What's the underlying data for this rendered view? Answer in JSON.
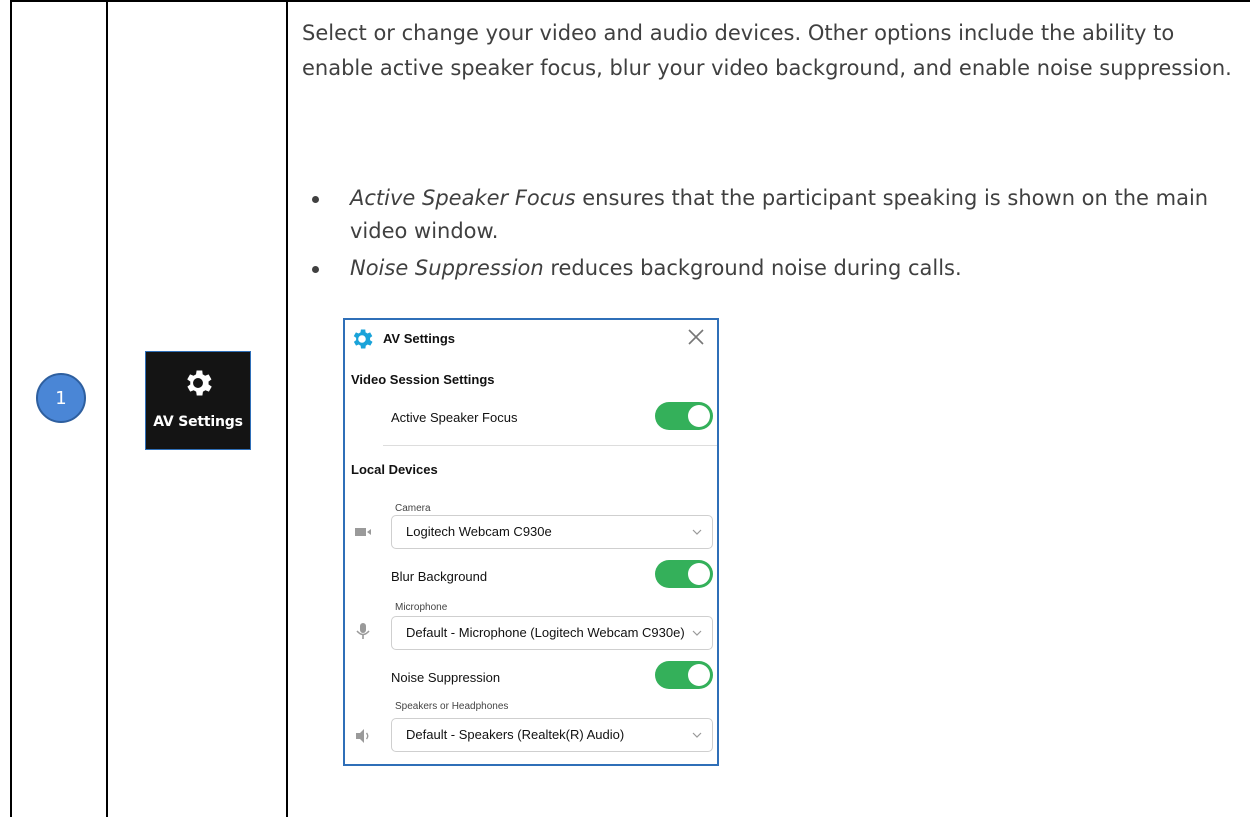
{
  "step": {
    "number": "1"
  },
  "tile": {
    "label": "AV Settings",
    "icon": "gear-icon"
  },
  "description": {
    "intro": "Select or change your video and audio devices. Other options include the ability to enable active speaker focus, blur your video background, and enable noise suppression.",
    "bullets": [
      {
        "term": "Active Speaker Focus",
        "text": " ensures that the participant speaking is shown on the main video window."
      },
      {
        "term": "Noise Suppression",
        "text": " reduces background noise during calls."
      }
    ]
  },
  "panel": {
    "title": "AV Settings",
    "video_section": "Video Session Settings",
    "active_speaker_label": "Active Speaker Focus",
    "active_speaker_on": true,
    "local_section": "Local Devices",
    "camera_label": "Camera",
    "camera_value": "Logitech Webcam C930e",
    "blur_label": "Blur Background",
    "blur_on": true,
    "mic_label": "Microphone",
    "mic_value": "Default - Microphone (Logitech Webcam C930e)",
    "noise_label": "Noise Suppression",
    "noise_on": true,
    "speaker_label": "Speakers or Headphones",
    "speaker_value": "Default - Speakers (Realtek(R) Audio)"
  },
  "colors": {
    "accent": "#1aa3d9",
    "toggle_on": "#34b05a",
    "step_circle": "#4a86d6",
    "panel_border": "#2f6fb8"
  }
}
